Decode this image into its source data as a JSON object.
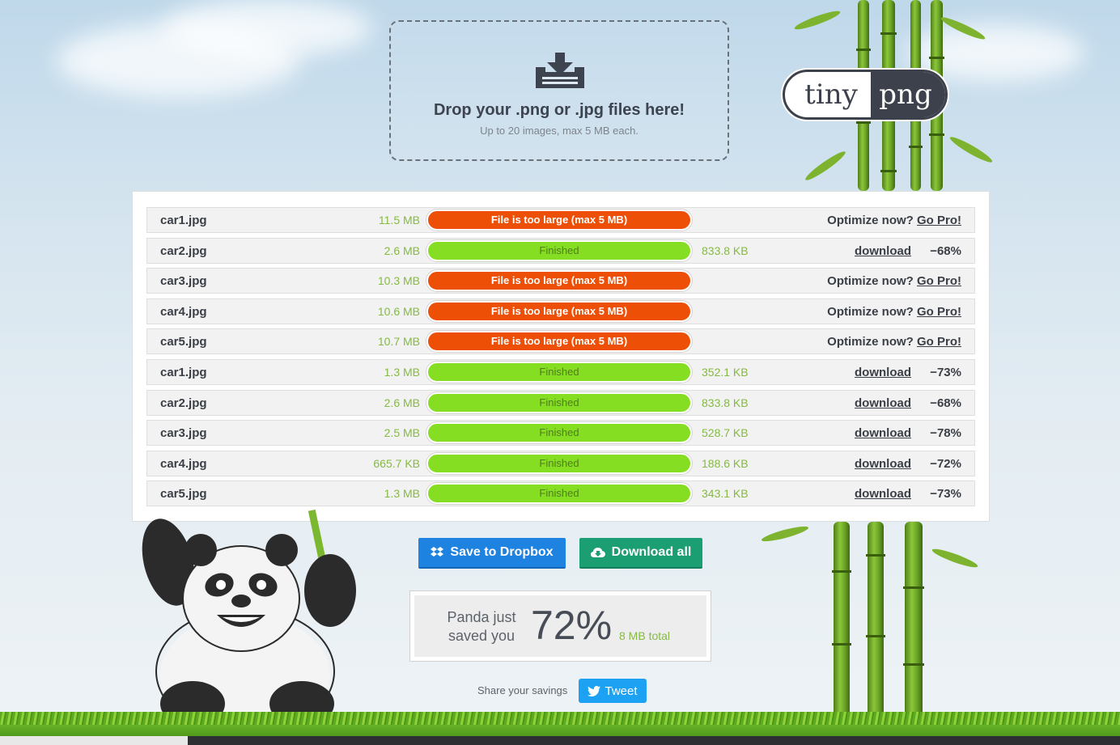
{
  "dropzone": {
    "title": "Drop your .png or .jpg files here!",
    "subtitle": "Up to 20 images, max 5 MB each.",
    "icon": "download-tray-icon"
  },
  "logo": {
    "left": "tiny",
    "right": "png"
  },
  "files": [
    {
      "name": "car1.jpg",
      "size": "11.5 MB",
      "status": "File is too large (max 5 MB)",
      "type": "error",
      "promo_text": "Optimize now?",
      "promo_link": "Go Pro!"
    },
    {
      "name": "car2.jpg",
      "size": "2.6 MB",
      "status": "Finished",
      "type": "done",
      "new_size": "833.8 KB",
      "download": "download",
      "saved": "−68%"
    },
    {
      "name": "car3.jpg",
      "size": "10.3 MB",
      "status": "File is too large (max 5 MB)",
      "type": "error",
      "promo_text": "Optimize now?",
      "promo_link": "Go Pro!"
    },
    {
      "name": "car4.jpg",
      "size": "10.6 MB",
      "status": "File is too large (max 5 MB)",
      "type": "error",
      "promo_text": "Optimize now?",
      "promo_link": "Go Pro!"
    },
    {
      "name": "car5.jpg",
      "size": "10.7 MB",
      "status": "File is too large (max 5 MB)",
      "type": "error",
      "promo_text": "Optimize now?",
      "promo_link": "Go Pro!"
    },
    {
      "name": "car1.jpg",
      "size": "1.3 MB",
      "status": "Finished",
      "type": "done",
      "new_size": "352.1 KB",
      "download": "download",
      "saved": "−73%"
    },
    {
      "name": "car2.jpg",
      "size": "2.6 MB",
      "status": "Finished",
      "type": "done",
      "new_size": "833.8 KB",
      "download": "download",
      "saved": "−68%"
    },
    {
      "name": "car3.jpg",
      "size": "2.5 MB",
      "status": "Finished",
      "type": "done",
      "new_size": "528.7 KB",
      "download": "download",
      "saved": "−78%"
    },
    {
      "name": "car4.jpg",
      "size": "665.7 KB",
      "status": "Finished",
      "type": "done",
      "new_size": "188.6 KB",
      "download": "download",
      "saved": "−72%"
    },
    {
      "name": "car5.jpg",
      "size": "1.3 MB",
      "status": "Finished",
      "type": "done",
      "new_size": "343.1 KB",
      "download": "download",
      "saved": "−73%"
    }
  ],
  "actions": {
    "dropbox_label": "Save to Dropbox",
    "dropbox_icon": "dropbox-icon",
    "download_all_label": "Download all",
    "download_all_icon": "cloud-download-icon"
  },
  "savings": {
    "label": "Panda just saved you",
    "percent": "72%",
    "total": "8 MB total"
  },
  "share": {
    "label": "Share your savings",
    "tweet_label": "Tweet",
    "tweet_icon": "twitter-bird-icon"
  },
  "colors": {
    "error": "#ee4f07",
    "finished": "#86de22",
    "size_text": "#86b945",
    "dropbox": "#1d82e0",
    "download_all": "#1a9e72",
    "twitter": "#1da1f2"
  }
}
